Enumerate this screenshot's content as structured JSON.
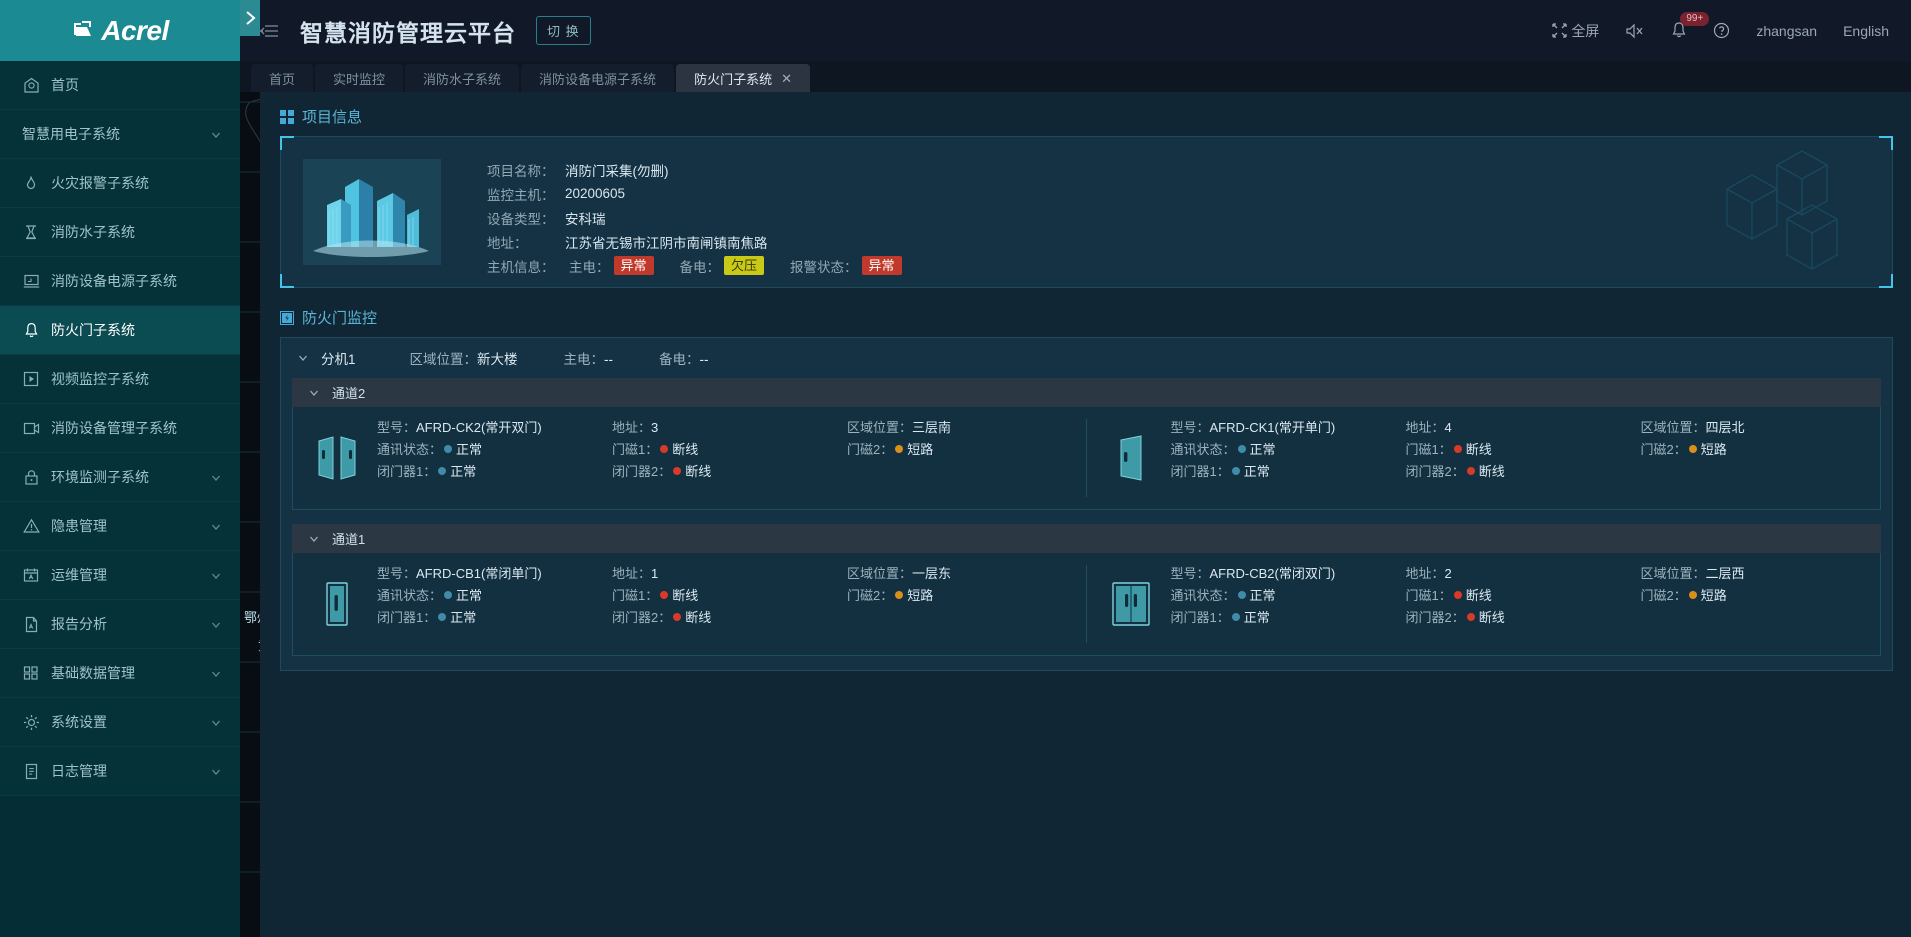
{
  "brand": {
    "name": "Acrel"
  },
  "sidebar": {
    "items": [
      {
        "label": "首页",
        "icon": "home-icon",
        "has_icon": true,
        "expandable": false,
        "active": false
      },
      {
        "label": "智慧用电子系统",
        "icon": "none",
        "has_icon": false,
        "expandable": true,
        "active": false
      },
      {
        "label": "火灾报警子系统",
        "icon": "fire-alarm-icon",
        "has_icon": true,
        "expandable": false,
        "active": false
      },
      {
        "label": "消防水子系统",
        "icon": "water-icon",
        "has_icon": true,
        "expandable": false,
        "active": false
      },
      {
        "label": "消防设备电源子系统",
        "icon": "power-icon",
        "has_icon": true,
        "expandable": false,
        "active": false
      },
      {
        "label": "防火门子系统",
        "icon": "bell-icon",
        "has_icon": true,
        "expandable": false,
        "active": true
      },
      {
        "label": "视频监控子系统",
        "icon": "video-icon",
        "has_icon": true,
        "expandable": false,
        "active": false
      },
      {
        "label": "消防设备管理子系统",
        "icon": "device-icon",
        "has_icon": true,
        "expandable": false,
        "active": false
      },
      {
        "label": "环境监测子系统",
        "icon": "lock-icon",
        "has_icon": true,
        "expandable": true,
        "active": false
      },
      {
        "label": "隐患管理",
        "icon": "warning-icon",
        "has_icon": true,
        "expandable": true,
        "active": false
      },
      {
        "label": "运维管理",
        "icon": "calendar-icon",
        "has_icon": true,
        "expandable": true,
        "active": false
      },
      {
        "label": "报告分析",
        "icon": "report-icon",
        "has_icon": true,
        "expandable": true,
        "active": false
      },
      {
        "label": "基础数据管理",
        "icon": "grid-icon",
        "has_icon": true,
        "expandable": true,
        "active": false
      },
      {
        "label": "系统设置",
        "icon": "gear-icon",
        "has_icon": true,
        "expandable": true,
        "active": false
      },
      {
        "label": "日志管理",
        "icon": "log-icon",
        "has_icon": true,
        "expandable": true,
        "active": false
      }
    ]
  },
  "topbar": {
    "title": "智慧消防管理云平台",
    "switch_label": "切 换",
    "fullscreen_label": "全屏",
    "notify_badge": "99+",
    "user": "zhangsan",
    "language": "English"
  },
  "tabs": [
    {
      "label": "首页",
      "active": false,
      "closable": false
    },
    {
      "label": "实时监控",
      "active": false,
      "closable": false
    },
    {
      "label": "消防水子系统",
      "active": false,
      "closable": false
    },
    {
      "label": "消防设备电源子系统",
      "active": false,
      "closable": false
    },
    {
      "label": "防火门子系统",
      "active": true,
      "closable": true,
      "close_glyph": "✕"
    }
  ],
  "map": {
    "cities": [
      {
        "label": "鄂州"
      },
      {
        "label": "黄石"
      }
    ]
  },
  "project_info": {
    "section_title": "项目信息",
    "fields": [
      {
        "label": "项目名称：",
        "value": "消防门采集(勿删)"
      },
      {
        "label": "监控主机：",
        "value": "20200605"
      },
      {
        "label": "设备类型：",
        "value": "安科瑞"
      },
      {
        "label": "地址：",
        "value": "江苏省无锡市江阴市南闸镇南焦路"
      }
    ],
    "host_row": {
      "label": "主机信息：",
      "items": [
        {
          "label": "主电：",
          "value": "异常",
          "style": "red"
        },
        {
          "label": "备电：",
          "value": "欠压",
          "style": "yellow"
        },
        {
          "label": "报警状态：",
          "value": "异常",
          "style": "red"
        }
      ]
    }
  },
  "door_monitor": {
    "section_title": "防火门监控",
    "hosts": [
      {
        "name": "分机1",
        "area_label": "区域位置：",
        "area_value": "新大楼",
        "main_power_label": "主电：",
        "main_power_value": "--",
        "backup_power_label": "备电：",
        "backup_power_value": "--",
        "channels": [
          {
            "name": "通道2",
            "devices": [
              {
                "icon": "door-double-open-icon",
                "model_label": "型号：",
                "model_value": "AFRD-CK2(常开双门)",
                "addr_label": "地址：",
                "addr_value": "3",
                "area_label": "区域位置：",
                "area_value": "三层南",
                "comm_label": "通讯状态：",
                "comm_value": "正常",
                "comm_dot": "blue",
                "mag1_label": "门磁1：",
                "mag1_value": "断线",
                "mag1_dot": "red",
                "mag2_label": "门磁2：",
                "mag2_value": "短路",
                "mag2_dot": "orange",
                "closer1_label": "闭门器1：",
                "closer1_value": "正常",
                "closer1_dot": "blue",
                "closer2_label": "闭门器2：",
                "closer2_value": "断线",
                "closer2_dot": "red"
              },
              {
                "icon": "door-single-open-icon",
                "model_label": "型号：",
                "model_value": "AFRD-CK1(常开单门)",
                "addr_label": "地址：",
                "addr_value": "4",
                "area_label": "区域位置：",
                "area_value": "四层北",
                "comm_label": "通讯状态：",
                "comm_value": "正常",
                "comm_dot": "blue",
                "mag1_label": "门磁1：",
                "mag1_value": "断线",
                "mag1_dot": "red",
                "mag2_label": "门磁2：",
                "mag2_value": "短路",
                "mag2_dot": "orange",
                "closer1_label": "闭门器1：",
                "closer1_value": "正常",
                "closer1_dot": "blue",
                "closer2_label": "闭门器2：",
                "closer2_value": "断线",
                "closer2_dot": "red"
              }
            ]
          },
          {
            "name": "通道1",
            "devices": [
              {
                "icon": "door-single-closed-icon",
                "model_label": "型号：",
                "model_value": "AFRD-CB1(常闭单门)",
                "addr_label": "地址：",
                "addr_value": "1",
                "area_label": "区域位置：",
                "area_value": "一层东",
                "comm_label": "通讯状态：",
                "comm_value": "正常",
                "comm_dot": "blue",
                "mag1_label": "门磁1：",
                "mag1_value": "断线",
                "mag1_dot": "red",
                "mag2_label": "门磁2：",
                "mag2_value": "短路",
                "mag2_dot": "orange",
                "closer1_label": "闭门器1：",
                "closer1_value": "正常",
                "closer1_dot": "blue",
                "closer2_label": "闭门器2：",
                "closer2_value": "断线",
                "closer2_dot": "red"
              },
              {
                "icon": "door-double-closed-icon",
                "model_label": "型号：",
                "model_value": "AFRD-CB2(常闭双门)",
                "addr_label": "地址：",
                "addr_value": "2",
                "area_label": "区域位置：",
                "area_value": "二层西",
                "comm_label": "通讯状态：",
                "comm_value": "正常",
                "comm_dot": "blue",
                "mag1_label": "门磁1：",
                "mag1_value": "断线",
                "mag1_dot": "red",
                "mag2_label": "门磁2：",
                "mag2_value": "短路",
                "mag2_dot": "orange",
                "closer1_label": "闭门器1：",
                "closer1_value": "正常",
                "closer1_dot": "blue",
                "closer2_label": "闭门器2：",
                "closer2_value": "断线",
                "closer2_dot": "red"
              }
            ]
          }
        ]
      }
    ]
  },
  "colors": {
    "brand_teal": "#1b8a93",
    "sidebar_bg": "#053239",
    "accent_blue": "#45c3e8",
    "status_red": "#c0392b",
    "status_yellow": "#c9c918",
    "dot_blue": "#3f8ba8",
    "dot_red": "#d93a28",
    "dot_orange": "#d98f1a"
  }
}
